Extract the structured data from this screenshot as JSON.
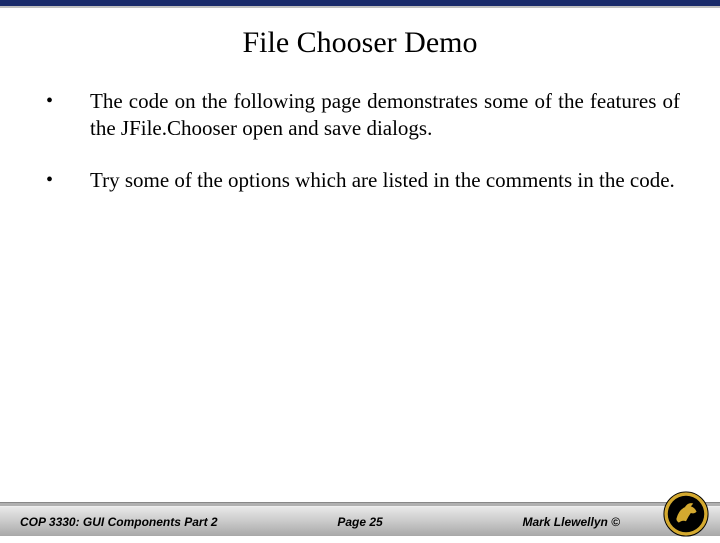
{
  "title": "File Chooser Demo",
  "bullets": [
    "The code on the following page demonstrates some of the features of the JFile.Chooser open and save dialogs.",
    "Try some of the options which are listed in the comments in the code."
  ],
  "footer": {
    "course": "COP 3330: GUI Components Part 2",
    "page": "Page 25",
    "author": "Mark Llewellyn ©"
  }
}
